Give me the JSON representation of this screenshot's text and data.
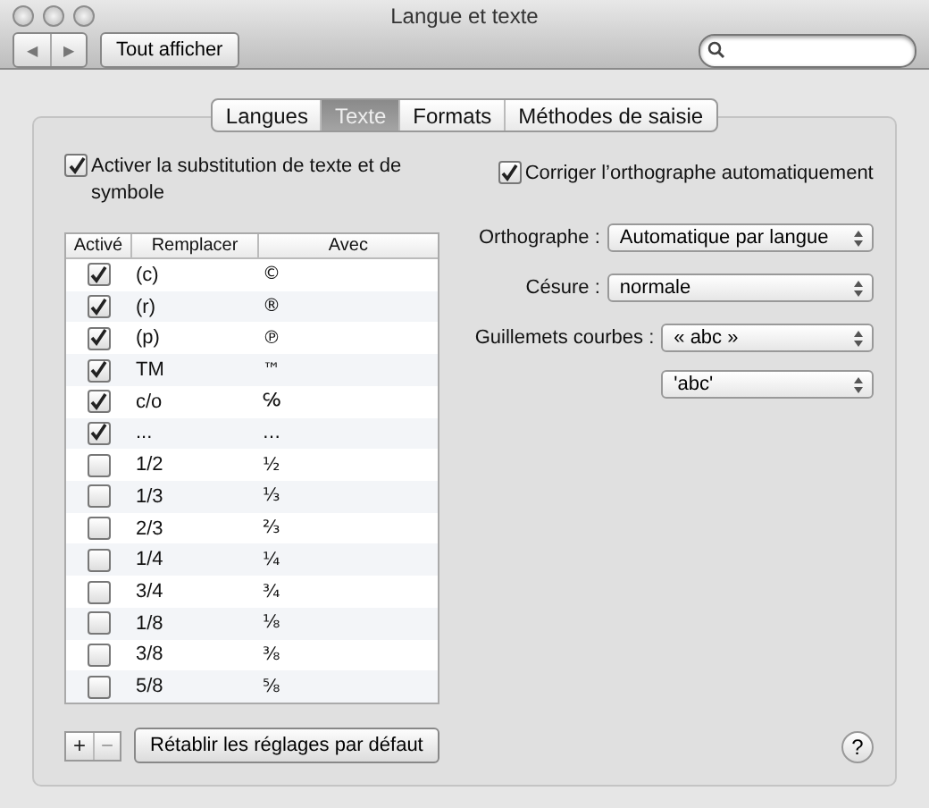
{
  "window": {
    "title": "Langue et texte"
  },
  "toolbar": {
    "back": "◀",
    "forward": "▶",
    "show_all": "Tout afficher"
  },
  "tabs": [
    {
      "label": "Langues",
      "selected": false
    },
    {
      "label": "Texte",
      "selected": true
    },
    {
      "label": "Formats",
      "selected": false
    },
    {
      "label": "Méthodes de saisie",
      "selected": false
    }
  ],
  "substitution": {
    "label": "Activer la substitution de texte et de symbole",
    "checked": true
  },
  "table": {
    "columns": [
      "Activé",
      "Remplacer",
      "Avec"
    ],
    "rows": [
      {
        "enabled": true,
        "replace": "(c)",
        "with": "©"
      },
      {
        "enabled": true,
        "replace": "(r)",
        "with": "®"
      },
      {
        "enabled": true,
        "replace": "(p)",
        "with": "℗"
      },
      {
        "enabled": true,
        "replace": "TM",
        "with": "™"
      },
      {
        "enabled": true,
        "replace": "c/o",
        "with": "℅"
      },
      {
        "enabled": true,
        "replace": "...",
        "with": "…"
      },
      {
        "enabled": false,
        "replace": "1/2",
        "with": "½"
      },
      {
        "enabled": false,
        "replace": "1/3",
        "with": "⅓"
      },
      {
        "enabled": false,
        "replace": "2/3",
        "with": "⅔"
      },
      {
        "enabled": false,
        "replace": "1/4",
        "with": "¼"
      },
      {
        "enabled": false,
        "replace": "3/4",
        "with": "¾"
      },
      {
        "enabled": false,
        "replace": "1/8",
        "with": "⅛"
      },
      {
        "enabled": false,
        "replace": "3/8",
        "with": "⅜"
      },
      {
        "enabled": false,
        "replace": "5/8",
        "with": "⅝"
      }
    ]
  },
  "add": "+",
  "remove": "−",
  "restore": "Rétablir les réglages par défaut",
  "spelling": {
    "label": "Corriger l’orthographe automatiquement",
    "checked": true
  },
  "popups": [
    {
      "label": "Orthographe :",
      "values": [
        "Automatique par langue"
      ]
    },
    {
      "label": "Césure :",
      "values": [
        "normale"
      ]
    },
    {
      "label": "Guillemets courbes :",
      "values": [
        "« abc »",
        "'abc'"
      ]
    }
  ],
  "help": "?"
}
